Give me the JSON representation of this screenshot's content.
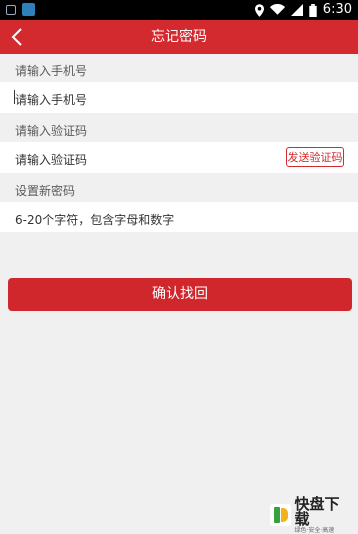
{
  "status_bar": {
    "time": "6:30",
    "icons": [
      "notification-icon",
      "app-icon",
      "location-icon",
      "wifi-icon",
      "signal-icon",
      "battery-icon"
    ]
  },
  "header": {
    "title": "忘记密码",
    "background": "#d32a2f"
  },
  "form": {
    "phone_label": "请输入手机号",
    "phone_placeholder": "请输入手机号",
    "code_label": "请输入验证码",
    "code_placeholder": "请输入验证码",
    "send_code_label": "发送验证码",
    "password_label": "设置新密码",
    "password_placeholder": "6-20个字符，包含字母和数字"
  },
  "confirm_button": {
    "label": "确认找回",
    "color": "#d0272d"
  },
  "watermark": {
    "brand": "快盘下载",
    "tagline": "绿色·安全·高速"
  }
}
